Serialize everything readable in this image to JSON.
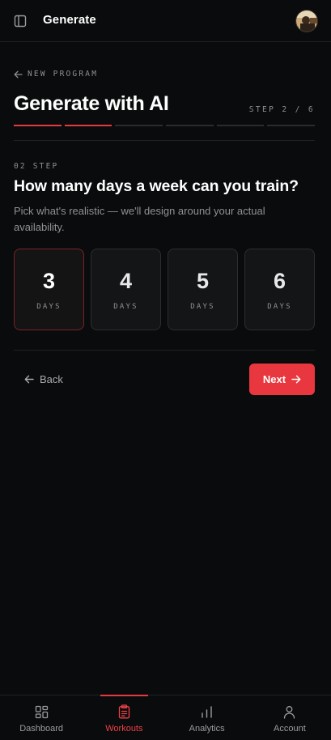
{
  "topbar": {
    "title": "Generate",
    "sidebar_icon": "sidebar-panel-icon",
    "avatar_icon": "user-avatar"
  },
  "header": {
    "back_label": "NEW PROGRAM",
    "title": "Generate with AI",
    "step_text": "STEP 2 / 6",
    "progress": {
      "current_step": 2,
      "total_steps": 6
    }
  },
  "question": {
    "step_label": "02 STEP",
    "title": "How many days a week can you train?",
    "hint": "Pick what's realistic — we'll design around your actual availability."
  },
  "options": [
    {
      "value": "3",
      "unit": "DAYS",
      "selected": true
    },
    {
      "value": "4",
      "unit": "DAYS",
      "selected": false
    },
    {
      "value": "5",
      "unit": "DAYS",
      "selected": false
    },
    {
      "value": "6",
      "unit": "DAYS",
      "selected": false
    }
  ],
  "actions": {
    "back_label": "Back",
    "next_label": "Next"
  },
  "bottom_nav": [
    {
      "label": "Dashboard",
      "icon": "dashboard-grid-icon",
      "active": false
    },
    {
      "label": "Workouts",
      "icon": "clipboard-icon",
      "active": true
    },
    {
      "label": "Analytics",
      "icon": "bar-chart-icon",
      "active": false
    },
    {
      "label": "Account",
      "icon": "user-icon",
      "active": false
    }
  ],
  "colors": {
    "accent": "#e8373f",
    "background": "#0a0b0c",
    "card": "#141517",
    "muted_text": "#8d8f93"
  }
}
